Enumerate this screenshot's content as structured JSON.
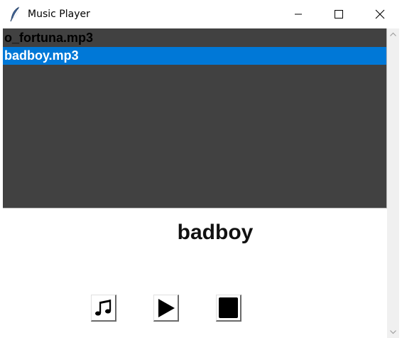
{
  "window": {
    "title": "Music Player",
    "title_icon": "feather-icon",
    "controls": [
      "minimize-icon",
      "maximize-icon",
      "close-icon"
    ]
  },
  "playlist": {
    "items": [
      {
        "label": "o_fortuna.mp3",
        "selected": false
      },
      {
        "label": "badboy.mp3",
        "selected": true
      }
    ],
    "selection_color": "#0078d7",
    "background_color": "#414141"
  },
  "now_playing": {
    "title": "badboy"
  },
  "controls": {
    "buttons": [
      {
        "name": "music-note-icon"
      },
      {
        "name": "play-icon"
      },
      {
        "name": "stop-icon"
      }
    ]
  }
}
